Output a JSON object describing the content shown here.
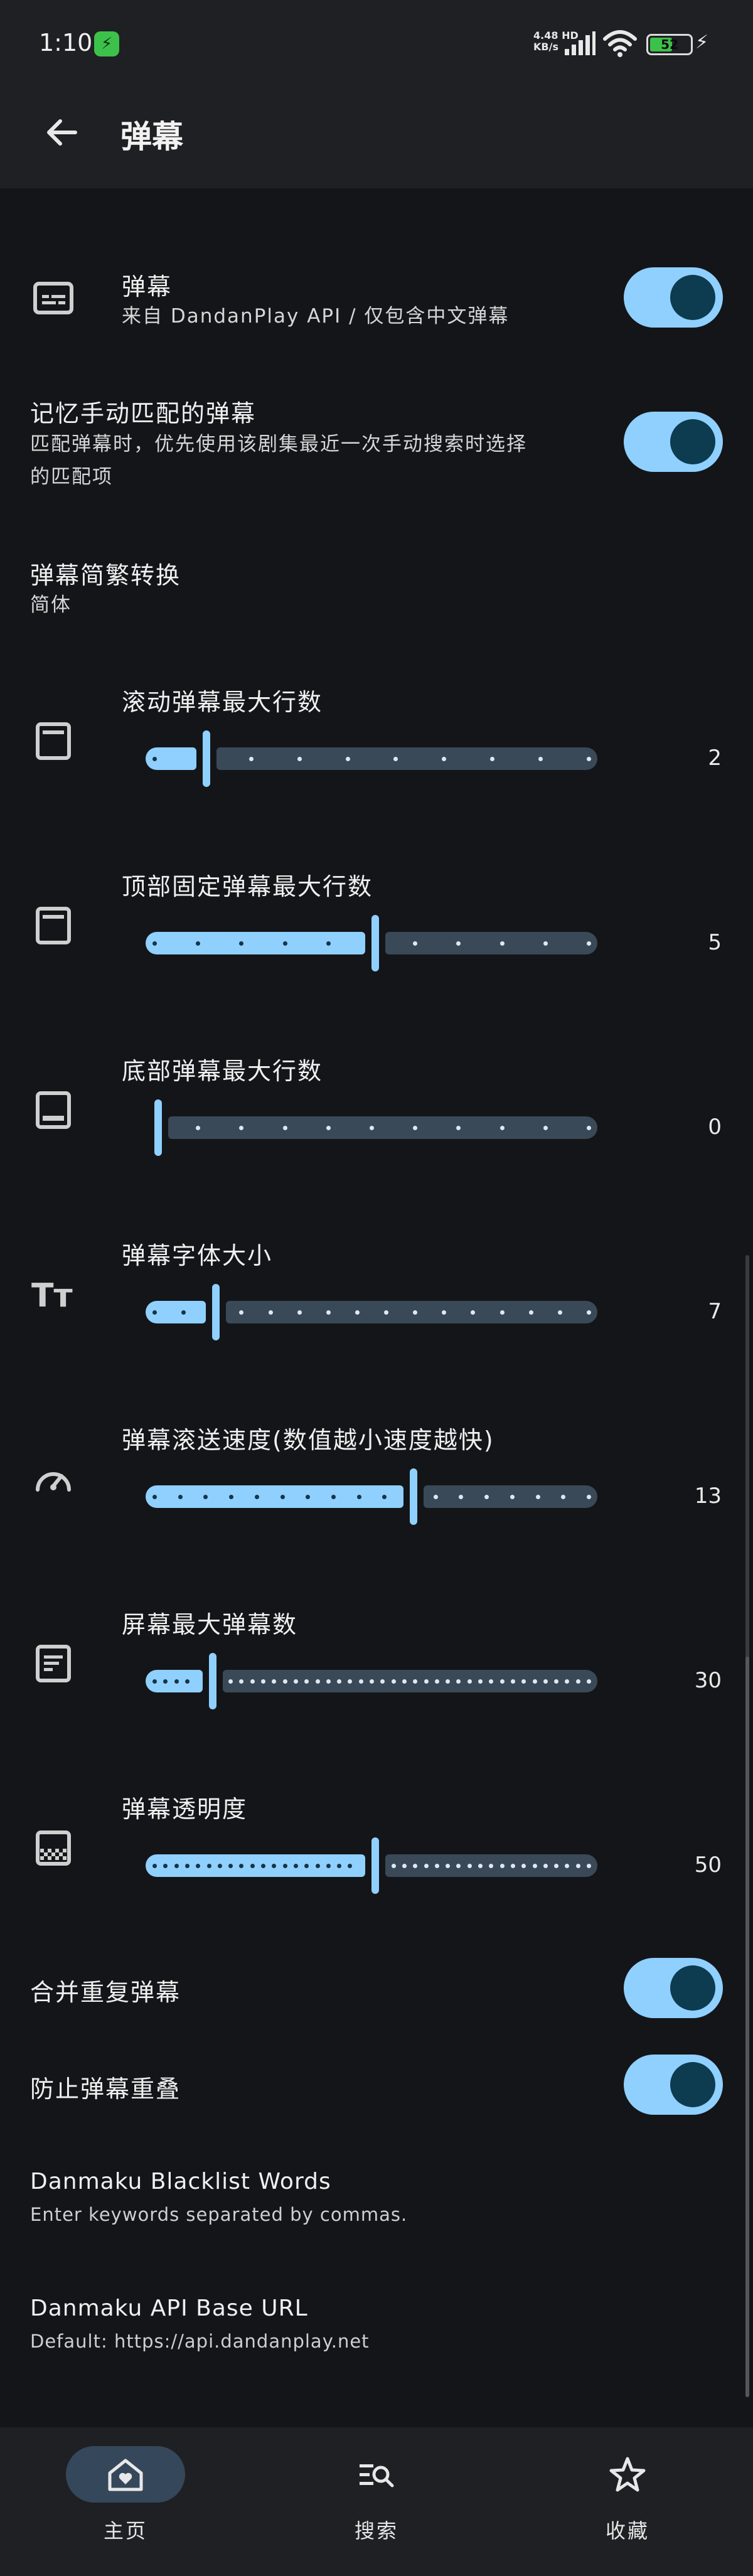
{
  "status_bar": {
    "time": "1:10",
    "net_speed_value": "4.48",
    "net_speed_unit": "KB/s",
    "net_type": "HD",
    "battery": "52"
  },
  "app_bar": {
    "title": "弹幕"
  },
  "settings": {
    "danmaku_toggle": {
      "title": "弹幕",
      "subtitle": "来自 DandanPlay API / 仅包含中文弹幕",
      "on": true
    },
    "remember_match": {
      "title": "记忆手动匹配的弹幕",
      "subtitle_line1": "匹配弹幕时，优先使用该剧集最近一次手动搜索时选择",
      "subtitle_line2": "的匹配项",
      "on": true
    },
    "conversion": {
      "title": "弹幕简繁转换",
      "value": "简体"
    },
    "scroll_max_lines": {
      "title": "滚动弹幕最大行数",
      "value": "2",
      "min": 1,
      "max": 10,
      "current": 2
    },
    "top_max_lines": {
      "title": "顶部固定弹幕最大行数",
      "value": "5",
      "min": 0,
      "max": 10,
      "current": 5
    },
    "bottom_max_lines": {
      "title": "底部弹幕最大行数",
      "value": "0",
      "min": 0,
      "max": 10,
      "current": 0
    },
    "font_size": {
      "title": "弹幕字体大小",
      "value": "7",
      "min": 5,
      "max": 20,
      "current": 7
    },
    "scroll_speed": {
      "title": "弹幕滚送速度(数值越小速度越快)",
      "value": "13",
      "min": 3,
      "max": 20,
      "current": 13
    },
    "screen_max": {
      "title": "屏幕最大弹幕数",
      "value": "30",
      "min": 20,
      "max": 100,
      "current": 30
    },
    "opacity": {
      "title": "弹幕透明度",
      "value": "50",
      "min": 0,
      "max": 100,
      "current": 50
    },
    "merge_duplicates": {
      "title": "合并重复弹幕",
      "on": true
    },
    "prevent_overlap": {
      "title": "防止弹幕重叠",
      "on": true
    },
    "blacklist": {
      "title": "Danmaku Blacklist Words",
      "subtitle": "Enter keywords separated by commas."
    },
    "api_base": {
      "title": "Danmaku API Base URL",
      "subtitle": "Default: https://api.dandanplay.net"
    }
  },
  "bottom_nav": [
    {
      "label": "主页",
      "icon": "home-heart-icon",
      "selected": true
    },
    {
      "label": "搜索",
      "icon": "search-list-icon",
      "selected": false
    },
    {
      "label": "收藏",
      "icon": "star-outline-icon",
      "selected": false
    }
  ],
  "colors": {
    "accent": "#8fd0ff",
    "knob": "#0d3b50",
    "track_inactive": "#3a4957",
    "background": "#141518",
    "surface": "#1f2023"
  }
}
